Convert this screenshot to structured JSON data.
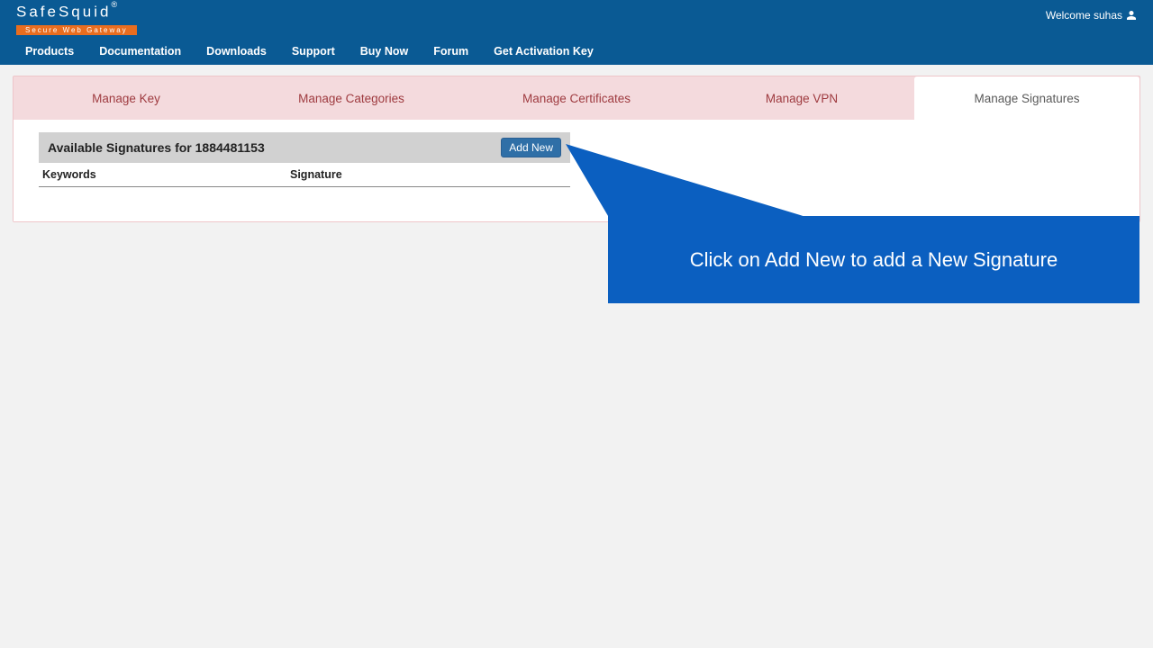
{
  "header": {
    "brand": "SafeSquid",
    "reg": "®",
    "tagline": "Secure Web Gateway",
    "welcome": "Welcome suhas"
  },
  "nav": {
    "products": "Products",
    "documentation": "Documentation",
    "downloads": "Downloads",
    "support": "Support",
    "buy_now": "Buy Now",
    "forum": "Forum",
    "activation": "Get Activation Key"
  },
  "tabs": {
    "manage_key": "Manage Key",
    "manage_categories": "Manage Categories",
    "manage_certificates": "Manage Certificates",
    "manage_vpn": "Manage VPN",
    "manage_signatures": "Manage Signatures"
  },
  "panel": {
    "title": "Available Signatures for 1884481153",
    "add_new": "Add New",
    "col_keywords": "Keywords",
    "col_signature": "Signature"
  },
  "callout": {
    "text": "Click on Add New to add a New Signature"
  }
}
